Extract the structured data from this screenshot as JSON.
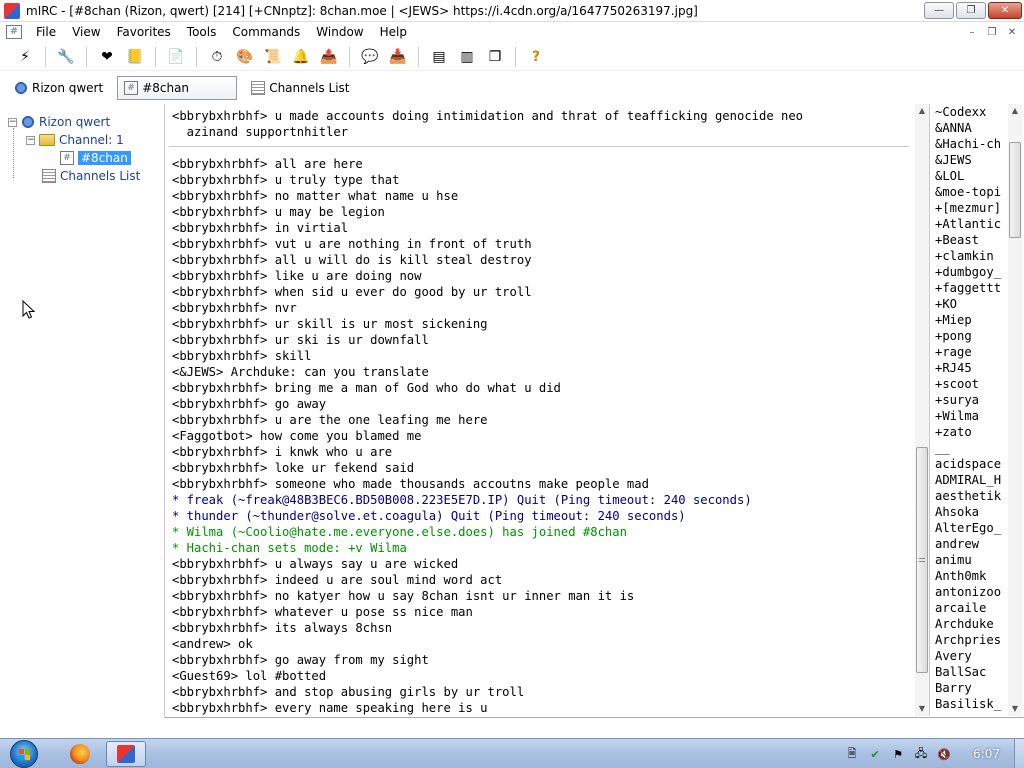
{
  "window": {
    "title": "mIRC - [#8chan (Rizon, qwert) [214] [+CNnptz]: 8chan.moe | <JEWS> https://i.4cdn.org/a/1647750263197.jpg]",
    "min_glyph": "—",
    "max_glyph": "❐",
    "close_glyph": "✕"
  },
  "menu": {
    "items": [
      "File",
      "View",
      "Favorites",
      "Tools",
      "Commands",
      "Window",
      "Help"
    ],
    "mdi": [
      "–",
      "❐",
      "✕"
    ]
  },
  "toolbar": {
    "buttons": [
      {
        "icon": "connect-icon",
        "glyph": "⚡"
      },
      {
        "icon": "options-icon",
        "glyph": "🔧"
      },
      {
        "icon": "favorites-icon",
        "glyph": "❤"
      },
      {
        "icon": "address-book-icon",
        "glyph": "📒"
      },
      {
        "icon": "logs-icon",
        "glyph": "📄"
      },
      {
        "icon": "timer-icon",
        "glyph": "⏱"
      },
      {
        "icon": "colors-icon",
        "glyph": "🎨"
      },
      {
        "icon": "scripts-icon",
        "glyph": "📜"
      },
      {
        "icon": "notify-icon",
        "glyph": "🔔"
      },
      {
        "icon": "dcc-send-icon",
        "glyph": "📤"
      },
      {
        "icon": "dcc-chat-icon",
        "glyph": "💬"
      },
      {
        "icon": "received-files-icon",
        "glyph": "📥"
      },
      {
        "icon": "tile-horizontal-icon",
        "glyph": "▤"
      },
      {
        "icon": "tile-vertical-icon",
        "glyph": "▥"
      },
      {
        "icon": "cascade-icon",
        "glyph": "❐"
      },
      {
        "icon": "help-icon",
        "glyph": "?"
      }
    ]
  },
  "switchbar": {
    "items": [
      {
        "label": "Rizon qwert",
        "kind": "server"
      },
      {
        "label": "#8chan",
        "kind": "channel",
        "active": true
      },
      {
        "label": "Channels List",
        "kind": "list"
      }
    ]
  },
  "tree": {
    "server": "Rizon qwert",
    "folder": "Channel: 1",
    "channel": "#8chan",
    "list": "Channels List",
    "collapse_glyph": "−",
    "channel_glyph": "#"
  },
  "chat": {
    "lines": [
      {
        "text": "<bbrybxhrbhf> u made accounts doing intimidation and thrat of teafficking genocide neo",
        "kind": "msg"
      },
      {
        "text": "  azinand supportnhitler",
        "kind": "msg"
      },
      {
        "text": "",
        "kind": "blank"
      },
      {
        "text": "<bbrybxhrbhf> all are here",
        "kind": "msg"
      },
      {
        "text": "<bbrybxhrbhf> u truly type that",
        "kind": "msg"
      },
      {
        "text": "<bbrybxhrbhf> no matter what name u hse",
        "kind": "msg"
      },
      {
        "text": "<bbrybxhrbhf> u may be legion",
        "kind": "msg"
      },
      {
        "text": "<bbrybxhrbhf> in virtial",
        "kind": "msg"
      },
      {
        "text": "<bbrybxhrbhf> vut u are nothing in front of truth",
        "kind": "msg"
      },
      {
        "text": "<bbrybxhrbhf> all u will do is kill steal destroy",
        "kind": "msg"
      },
      {
        "text": "<bbrybxhrbhf> like u are doing now",
        "kind": "msg"
      },
      {
        "text": "<bbrybxhrbhf> when sid u ever do good by ur troll",
        "kind": "msg"
      },
      {
        "text": "<bbrybxhrbhf> nvr",
        "kind": "msg"
      },
      {
        "text": "<bbrybxhrbhf> ur skill is ur most sickening",
        "kind": "msg"
      },
      {
        "text": "<bbrybxhrbhf> ur ski is ur downfall",
        "kind": "msg"
      },
      {
        "text": "<bbrybxhrbhf> skill",
        "kind": "msg"
      },
      {
        "text": "<&JEWS> Archduke: can you translate",
        "kind": "msg"
      },
      {
        "text": "<bbrybxhrbhf> bring me a man of God who do what u did",
        "kind": "msg"
      },
      {
        "text": "<bbrybxhrbhf> go away",
        "kind": "msg"
      },
      {
        "text": "<bbrybxhrbhf> u are the one leafing me here",
        "kind": "msg"
      },
      {
        "text": "<Faggotbot> how come you blamed me",
        "kind": "msg"
      },
      {
        "text": "<bbrybxhrbhf> i knwk who u are",
        "kind": "msg"
      },
      {
        "text": "<bbrybxhrbhf> loke ur fekend said",
        "kind": "msg"
      },
      {
        "text": "<bbrybxhrbhf> someone who made thousands accoutns make people mad",
        "kind": "msg"
      },
      {
        "text": "* freak (~freak@48B3BEC6.BD50B008.223E5E7D.IP) Quit (Ping timeout: 240 seconds)",
        "kind": "quit"
      },
      {
        "text": "* thunder (~thunder@solve.et.coagula) Quit (Ping timeout: 240 seconds)",
        "kind": "quit"
      },
      {
        "text": "* Wilma (~Coolio@hate.me.everyone.else.does) has joined #8chan",
        "kind": "join"
      },
      {
        "text": "* Hachi-chan sets mode: +v Wilma",
        "kind": "mode"
      },
      {
        "text": "<bbrybxhrbhf> u always say u are wicked",
        "kind": "msg"
      },
      {
        "text": "<bbrybxhrbhf> indeed u are soul mind word act",
        "kind": "msg"
      },
      {
        "text": "<bbrybxhrbhf> no katyer how u say 8chan isnt ur inner man it is",
        "kind": "msg"
      },
      {
        "text": "<bbrybxhrbhf> whatever u pose ss nice man",
        "kind": "msg"
      },
      {
        "text": "<bbrybxhrbhf> its always 8chsn",
        "kind": "msg"
      },
      {
        "text": "<andrew> ok",
        "kind": "msg"
      },
      {
        "text": "<bbrybxhrbhf> go away from my sight",
        "kind": "msg"
      },
      {
        "text": "<Guest69> lol #botted",
        "kind": "msg"
      },
      {
        "text": "<bbrybxhrbhf> and stop abusing girls by ur troll",
        "kind": "msg"
      },
      {
        "text": "<bbrybxhrbhf> every name speaking here is u",
        "kind": "msg"
      }
    ],
    "colors": {
      "quit": "#00007f",
      "join": "#009300",
      "mode": "#009300"
    },
    "scroll_position": 0.92
  },
  "nicklist": {
    "nicks": [
      "~Codexx",
      "&ANNA",
      "&Hachi-ch",
      "&JEWS",
      "&LOL",
      "&moe-topi",
      "+[mezmur]",
      "+Atlantic",
      "+Beast",
      "+clamkin",
      "+dumbgoy_",
      "+faggettt",
      "+KO",
      "+Miep",
      "+pong",
      "+rage",
      "+RJ45",
      "+scoot",
      "+surya",
      "+Wilma",
      "+zato",
      "__",
      "acidspace",
      "ADMIRAL_H",
      "aesthetik",
      "Ahsoka",
      "AlterEgo_",
      "andrew",
      "animu",
      "Anth0mk",
      "antonizoo",
      "arcaile",
      "Archduke",
      "Archpries",
      "Avery",
      "BallSac",
      "Barry",
      "Basilisk_"
    ],
    "scroll_position": 0.05
  },
  "editbox": {
    "value": ""
  },
  "taskbar": {
    "tasks": [
      {
        "name": "firefox",
        "active": false
      },
      {
        "name": "mirc",
        "active": true
      }
    ],
    "tray": [
      {
        "icon": "document-icon",
        "glyph": "🗎"
      },
      {
        "icon": "security-icon",
        "glyph": "✔"
      },
      {
        "icon": "action-center-flag-icon",
        "glyph": "⚑"
      },
      {
        "icon": "network-icon",
        "glyph": "🖧"
      },
      {
        "icon": "volume-muted-icon",
        "glyph": "🔇"
      }
    ],
    "clock": "6:07"
  }
}
